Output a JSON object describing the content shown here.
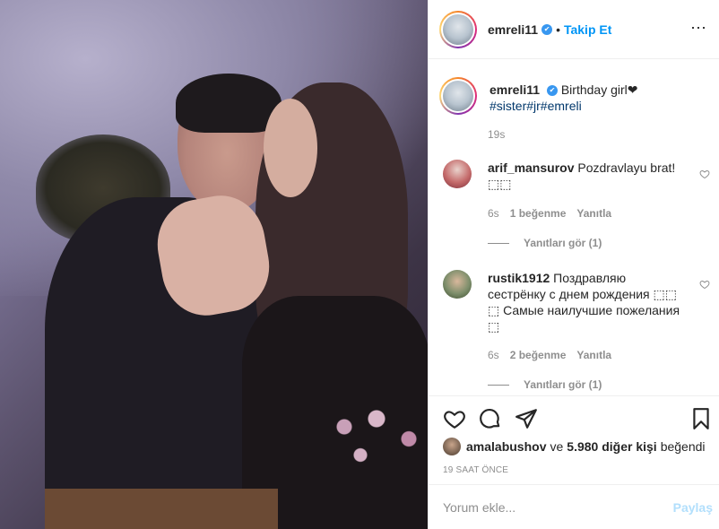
{
  "post": {
    "username": "emreli11",
    "verified_mark": "✔",
    "separator": "•",
    "follow_label": "Takip Et",
    "more_icon": "⋯"
  },
  "caption": {
    "username": "emreli11",
    "text": "Birthday girl❤",
    "hashtags": "#sister#jr#emreli",
    "time": "19s"
  },
  "comments": [
    {
      "username": "arif_mansurov",
      "text": "Pozdravlayu brat! ⬚⬚",
      "time": "6s",
      "likes": "1 beğenme",
      "reply_label": "Yanıtla",
      "view_replies": "Yanıtları gör (1)"
    },
    {
      "username": "rustik1912",
      "text": "Поздравляю сестрёнку с днем рождения ⬚⬚ ⬚ Самые наилучшие пожелания ⬚",
      "time": "6s",
      "likes": "2 beğenme",
      "reply_label": "Yanıtla",
      "view_replies": "Yanıtları gör (1)"
    }
  ],
  "likes": {
    "user": "amalabushov",
    "connector": "ve",
    "others": "5.980 diğer kişi",
    "suffix": "beğendi"
  },
  "posted_ago": "19 SAAT ÖNCE",
  "comment_box": {
    "placeholder": "Yorum ekle...",
    "share_label": "Paylaş"
  },
  "icons": {
    "like": "heart-icon",
    "comment": "comment-icon",
    "share": "send-icon",
    "save": "bookmark-icon"
  },
  "colors": {
    "link_blue": "#0095f6",
    "verified_blue": "#3897f0",
    "hashtag": "#00376b",
    "muted": "#8e8e8e",
    "share_disabled": "#b2dffc"
  }
}
